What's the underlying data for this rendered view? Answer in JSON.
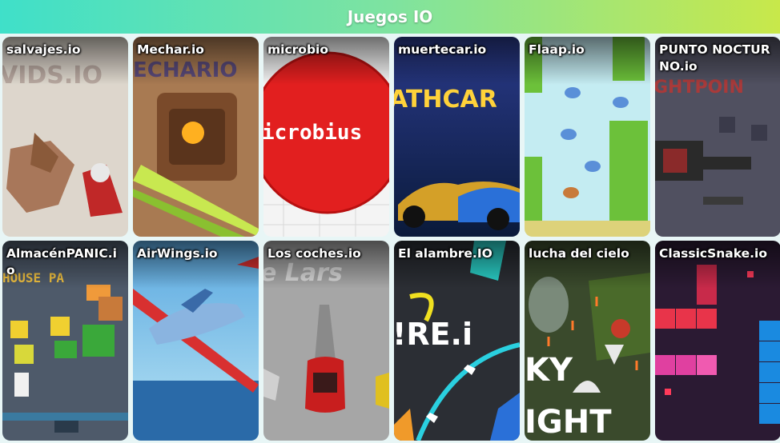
{
  "header": {
    "title": "Juegos IO"
  },
  "games": [
    {
      "title": "salvajes.io",
      "bg": "#d9d2c8",
      "accent": "#b33a2a"
    },
    {
      "title": "Mechar.io",
      "bg": "#b07a4a",
      "accent": "#c8e850"
    },
    {
      "title": "microbio",
      "bg": "#f2f2f2",
      "accent": "#e12626"
    },
    {
      "title": "muertecar.io",
      "bg": "#1b2a5a",
      "accent": "#ffd23a"
    },
    {
      "title": "Flaap.io",
      "bg": "#bfe8f0",
      "accent": "#6bc13a"
    },
    {
      "title": "PUNTO NOCTURNO.io",
      "bg": "#4a4a56",
      "accent": "#8a2a2a"
    },
    {
      "title": "AlmacénPANIC.io",
      "bg": "#4a5566",
      "accent": "#f09a3a"
    },
    {
      "title": "AirWings.io",
      "bg": "#5aa8e0",
      "accent": "#d83030"
    },
    {
      "title": "Los coches.io",
      "bg": "#a8a8a8",
      "accent": "#c81e1e"
    },
    {
      "title": "El alambre.IO",
      "bg": "#2a2d33",
      "accent": "#2ad0e0"
    },
    {
      "title": "lucha del cielo",
      "bg": "#3a4a2a",
      "accent": "#ff7a2a"
    },
    {
      "title": "ClassicSnake.io",
      "bg": "#2b1a33",
      "accent": "#ff3a5a"
    }
  ]
}
